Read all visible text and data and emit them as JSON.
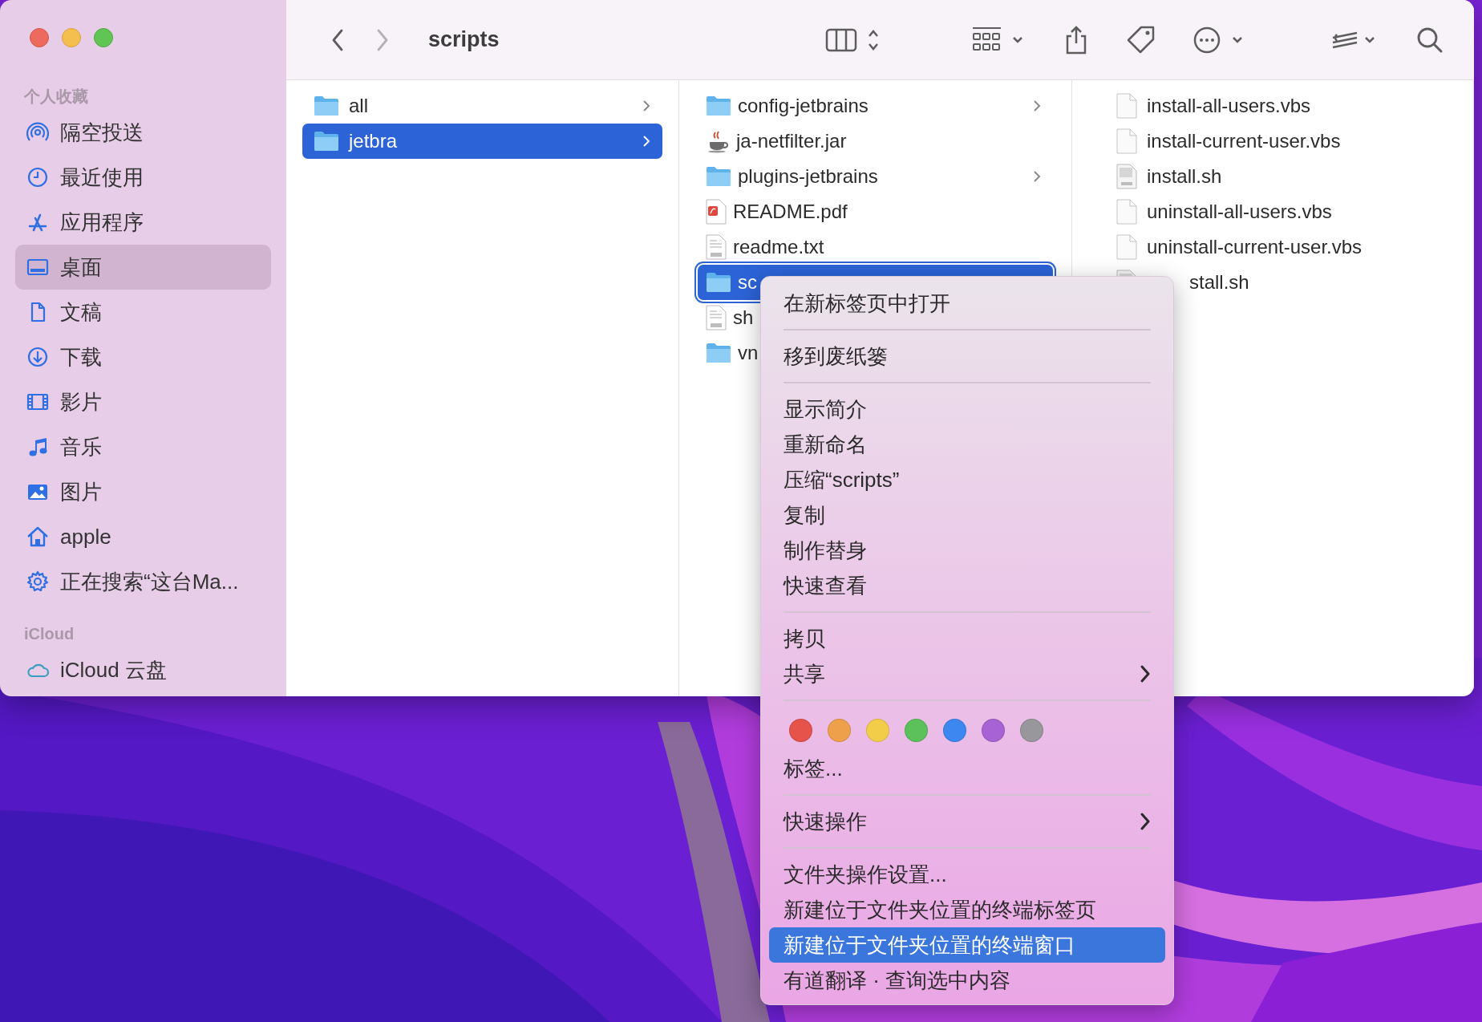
{
  "window": {
    "title": "scripts"
  },
  "navigation": [
    {
      "kind": "back",
      "disabled": false
    },
    {
      "kind": "forward",
      "disabled": true
    }
  ],
  "sidebar": {
    "sections": [
      {
        "heading": "个人收藏",
        "items": [
          {
            "label": "隔空投送",
            "kind": "airdrop",
            "selected": false
          },
          {
            "label": "最近使用",
            "kind": "recents",
            "selected": false
          },
          {
            "label": "应用程序",
            "kind": "applications",
            "selected": false
          },
          {
            "label": "桌面",
            "kind": "desktop",
            "selected": true
          },
          {
            "label": "文稿",
            "kind": "documents",
            "selected": false
          },
          {
            "label": "下载",
            "kind": "downloads",
            "selected": false
          },
          {
            "label": "影片",
            "kind": "movies",
            "selected": false
          },
          {
            "label": "音乐",
            "kind": "music",
            "selected": false
          },
          {
            "label": "图片",
            "kind": "pictures",
            "selected": false
          },
          {
            "label": "apple",
            "kind": "home",
            "selected": false
          },
          {
            "label": "正在搜索“这台Ma...",
            "kind": "search",
            "selected": false
          }
        ]
      },
      {
        "heading": "iCloud",
        "items": [
          {
            "label": "iCloud 云盘",
            "kind": "cloud",
            "selected": false
          }
        ]
      }
    ]
  },
  "columns": [
    {
      "items": [
        {
          "name": "all",
          "kind": "folder",
          "expandable": true,
          "selected": false,
          "focused": false
        },
        {
          "name": "jetbra",
          "kind": "folder",
          "expandable": true,
          "selected": true,
          "focused": false
        }
      ]
    },
    {
      "items": [
        {
          "name": "config-jetbrains",
          "kind": "folder",
          "expandable": true,
          "selected": false,
          "focused": false
        },
        {
          "name": "ja-netfilter.jar",
          "kind": "jar",
          "expandable": false,
          "selected": false,
          "focused": false
        },
        {
          "name": "plugins-jetbrains",
          "kind": "folder",
          "expandable": true,
          "selected": false,
          "focused": false
        },
        {
          "name": "README.pdf",
          "kind": "pdf",
          "expandable": false,
          "selected": false,
          "focused": false
        },
        {
          "name": "readme.txt",
          "kind": "txt",
          "expandable": false,
          "selected": false,
          "focused": false
        },
        {
          "name": "sc",
          "kind": "folder",
          "expandable": false,
          "selected": true,
          "focused": true
        },
        {
          "name": "sh",
          "kind": "txt",
          "expandable": false,
          "selected": false,
          "focused": false
        },
        {
          "name": "vn",
          "kind": "folder",
          "expandable": false,
          "selected": false,
          "focused": false
        }
      ]
    },
    {
      "items": [
        {
          "name": "install-all-users.vbs",
          "kind": "doc",
          "expandable": false,
          "selected": false,
          "focused": false
        },
        {
          "name": "install-current-user.vbs",
          "kind": "doc",
          "expandable": false,
          "selected": false,
          "focused": false
        },
        {
          "name": "install.sh",
          "kind": "shell",
          "expandable": false,
          "selected": false,
          "focused": false
        },
        {
          "name": "uninstall-all-users.vbs",
          "kind": "doc",
          "expandable": false,
          "selected": false,
          "focused": false
        },
        {
          "name": "uninstall-current-user.vbs",
          "kind": "doc",
          "expandable": false,
          "selected": false,
          "focused": false
        },
        {
          "name": "stall.sh",
          "kind": "shell",
          "expandable": false,
          "selected": false,
          "focused": false
        }
      ]
    }
  ],
  "context_menu": {
    "items": [
      {
        "kind": "item",
        "label": "在新标签页中打开",
        "submenu": false,
        "selected": false
      },
      {
        "kind": "separator"
      },
      {
        "kind": "item",
        "label": "移到废纸篓",
        "submenu": false,
        "selected": false
      },
      {
        "kind": "separator"
      },
      {
        "kind": "item",
        "label": "显示简介",
        "submenu": false,
        "selected": false
      },
      {
        "kind": "item",
        "label": "重新命名",
        "submenu": false,
        "selected": false
      },
      {
        "kind": "item",
        "label": "压缩“scripts”",
        "submenu": false,
        "selected": false
      },
      {
        "kind": "item",
        "label": "复制",
        "submenu": false,
        "selected": false
      },
      {
        "kind": "item",
        "label": "制作替身",
        "submenu": false,
        "selected": false
      },
      {
        "kind": "item",
        "label": "快速查看",
        "submenu": false,
        "selected": false
      },
      {
        "kind": "separator"
      },
      {
        "kind": "item",
        "label": "拷贝",
        "submenu": false,
        "selected": false
      },
      {
        "kind": "item",
        "label": "共享",
        "submenu": true,
        "selected": false
      },
      {
        "kind": "separator"
      },
      {
        "kind": "tags",
        "colors": [
          {
            "color": "#e5534b"
          },
          {
            "color": "#eea04a"
          },
          {
            "color": "#f2cd4a"
          },
          {
            "color": "#5cc15b"
          },
          {
            "color": "#3d87f0"
          },
          {
            "color": "#a763d4"
          },
          {
            "color": "#98989c"
          }
        ]
      },
      {
        "kind": "item",
        "label": "标签...",
        "submenu": false,
        "selected": false
      },
      {
        "kind": "separator"
      },
      {
        "kind": "item",
        "label": "快速操作",
        "submenu": true,
        "selected": false
      },
      {
        "kind": "separator"
      },
      {
        "kind": "item",
        "label": "文件夹操作设置...",
        "submenu": false,
        "selected": false
      },
      {
        "kind": "item",
        "label": "新建位于文件夹位置的终端标签页",
        "submenu": false,
        "selected": false
      },
      {
        "kind": "item",
        "label": "新建位于文件夹位置的终端窗口",
        "submenu": false,
        "selected": true
      },
      {
        "kind": "item",
        "label": "有道翻译 · 查询选中内容",
        "submenu": false,
        "selected": false
      }
    ]
  }
}
